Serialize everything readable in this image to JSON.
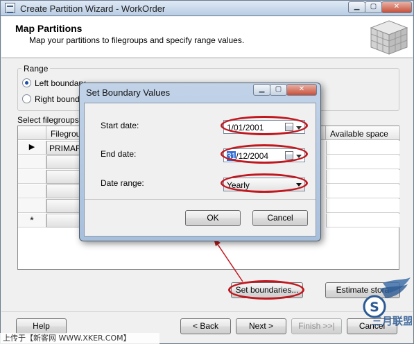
{
  "window": {
    "title": "Create Partition Wizard - WorkOrder"
  },
  "header": {
    "title": "Map Partitions",
    "subtitle": "Map your partitions to filegroups and specify range values."
  },
  "range": {
    "group_label": "Range",
    "left_option": "Left boundary",
    "right_option": "Right boundar",
    "selected": "left"
  },
  "grid": {
    "label": "Select filegroups ar",
    "columns": {
      "filegroup": "Filegroup",
      "available": "Available space"
    },
    "rows": [
      {
        "indicator": "▶",
        "filegroup": "PRIMARY"
      },
      {
        "indicator": "",
        "filegroup": ""
      },
      {
        "indicator": "",
        "filegroup": ""
      },
      {
        "indicator": "",
        "filegroup": ""
      },
      {
        "indicator": "",
        "filegroup": ""
      },
      {
        "indicator": "*",
        "filegroup": ""
      }
    ]
  },
  "buttons": {
    "set_boundaries": "Set boundaries...",
    "estimate_storage": "Estimate stora",
    "help": "Help",
    "back": "< Back",
    "next": "Next >",
    "finish": "Finish >>|",
    "cancel": "Cancel"
  },
  "dialog": {
    "title": "Set Boundary Values",
    "start_label": "Start date:",
    "start_value": "1/01/2001",
    "end_label": "End date:",
    "end_day": "31",
    "end_rest": "/12/2004",
    "range_label": "Date range:",
    "range_value": "Yearly",
    "ok": "OK",
    "cancel": "Cancel"
  },
  "watermark": {
    "upload_text": "上传于【新客网 WWW.XKER.COM】"
  },
  "colors": {
    "annotation": "#c0181e",
    "title_gradient_top": "#dfe9f5",
    "selection": "#3470d6"
  }
}
